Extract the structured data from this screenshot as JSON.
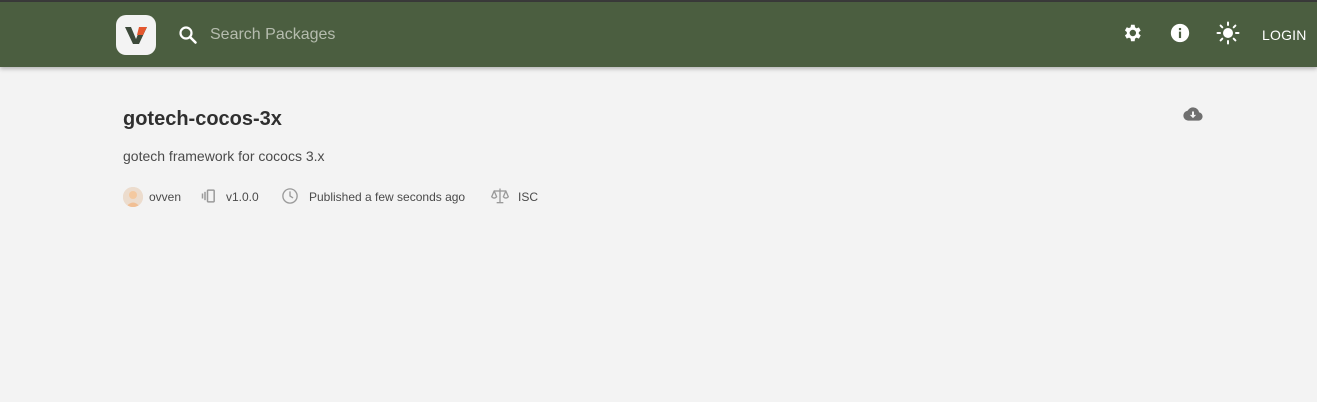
{
  "header": {
    "logo_icon": "verdaccio-logo-icon",
    "search_placeholder": "Search Packages",
    "settings_icon": "gear-icon",
    "info_icon": "info-icon",
    "theme_icon": "sun-icon",
    "login_label": "LOGIN",
    "bar_color": "#4b5e40"
  },
  "package": {
    "name": "gotech-cocos-3x",
    "description": "gotech framework for cococs 3.x",
    "download_icon": "cloud-download-icon",
    "author": "ovven",
    "version": "v1.0.0",
    "published": "Published a few seconds ago",
    "license": "ISC"
  }
}
